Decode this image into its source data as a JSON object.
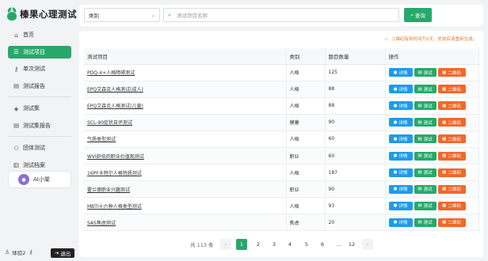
{
  "app": {
    "logo_text": "榛果心理测试"
  },
  "sidebar": {
    "items": [
      {
        "label": "首页",
        "icon": "home-icon",
        "glyph": "⌂"
      },
      {
        "label": "测试项目",
        "icon": "list-icon",
        "glyph": "☰",
        "active": true
      },
      {
        "label": "单次测试",
        "icon": "key-icon",
        "glyph": "⚷"
      },
      {
        "label": "测试报告",
        "icon": "report-icon",
        "glyph": "▤"
      },
      {
        "label": "测试集",
        "icon": "cube-icon",
        "glyph": "◈"
      },
      {
        "label": "测试集报告",
        "icon": "report-set-icon",
        "glyph": "▤"
      },
      {
        "label": "团体测试",
        "icon": "group-icon",
        "glyph": "⚇"
      },
      {
        "label": "测试档案",
        "icon": "archive-icon",
        "glyph": "▥"
      }
    ],
    "ai_label": "AI小棠",
    "user_label": "体验2",
    "logout_label": "退出"
  },
  "search": {
    "category_value": "类别",
    "placeholder": "测试项目名称",
    "button_label": "查询"
  },
  "notice": "二维码有效时间为1天，失效后请重新生成。",
  "table": {
    "headers": [
      "测试项目",
      "类别",
      "题目数量",
      "操作"
    ],
    "actions": {
      "detail": "详情",
      "test": "测试",
      "qr": "二维码"
    },
    "rows": [
      {
        "name": "PDQ-4+人格障碍测试",
        "category": "人格",
        "count": "125"
      },
      {
        "name": "EPQ艾森克人格测试(成人)",
        "category": "人格",
        "count": "88"
      },
      {
        "name": "EPQ艾森克人格测试(儿童)",
        "category": "人格",
        "count": "88"
      },
      {
        "name": "SCL-90症状自评测试",
        "category": "健康",
        "count": "90"
      },
      {
        "name": "气质类型测试",
        "category": "人格",
        "count": "60"
      },
      {
        "name": "WVI舒伯的职业价值观测试",
        "category": "职业",
        "count": "60"
      },
      {
        "name": "16PF卡特尔人格特质测试",
        "category": "人格",
        "count": "187"
      },
      {
        "name": "霍兰德职业兴趣测试",
        "category": "职业",
        "count": "90"
      },
      {
        "name": "MBTI十六种人格类型测试",
        "category": "人格",
        "count": "93"
      },
      {
        "name": "SAS焦虑测试",
        "category": "焦虑",
        "count": "20"
      }
    ]
  },
  "pagination": {
    "total_label": "共 113 条",
    "prev": "‹",
    "next": "›",
    "pages": [
      "1",
      "2",
      "3",
      "4",
      "5",
      "6",
      "...",
      "12"
    ],
    "current": "1"
  },
  "colors": {
    "accent": "#27a86a",
    "detail": "#1e9be8",
    "qr": "#f0682b",
    "notice": "#e27a2b"
  }
}
